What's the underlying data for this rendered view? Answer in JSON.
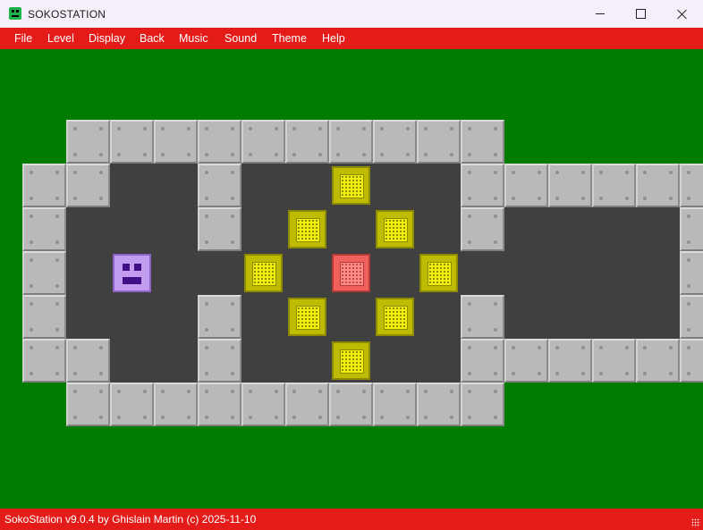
{
  "window": {
    "title": "SOKOSTATION"
  },
  "menu": [
    "File",
    "Level",
    "Display",
    "Back",
    "Music",
    "Sound",
    "Theme",
    "Help"
  ],
  "board": {
    "tile_colors": {
      "background": "#017c00",
      "floor": "#404040",
      "wall": "#b9b9b9",
      "box": "#f0ee10",
      "box_on_floor": "#ff8a86",
      "player": "#c19cf0"
    },
    "rows": [
      " WWWWWWWWWW     ",
      "WW  W  B  WWWWWW",
      "W   W B B W    W",
      "W P  B R B     W",
      "W   W B B W    W",
      "WW  W  B  WWWWWW",
      " WWWWWWWWWW     "
    ]
  },
  "statusbar": {
    "text": "SokoStation v9.0.4 by Ghislain Martin (c) 2025-11-10"
  }
}
